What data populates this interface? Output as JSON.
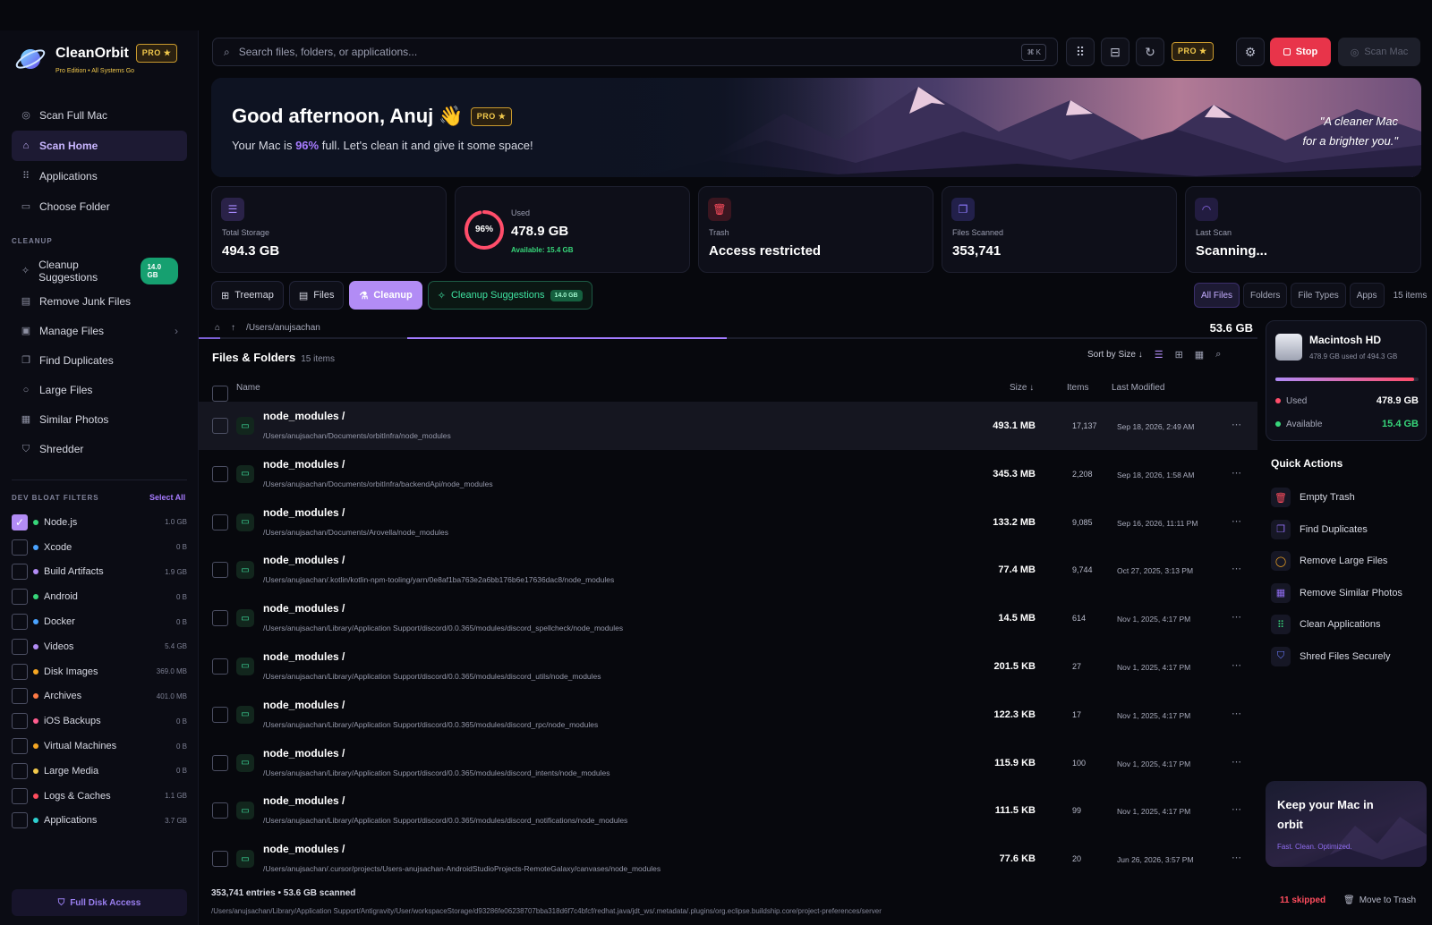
{
  "app": {
    "name": "CleanOrbit",
    "pro_badge": "PRO ★",
    "subtitle": "Pro Edition • All Systems Go",
    "accent": "#b28cf5"
  },
  "sidebar": {
    "main_items": [
      {
        "label": "Scan Full Mac",
        "icon": "scan-icon",
        "active": false
      },
      {
        "label": "Scan Home",
        "icon": "home-icon",
        "active": true
      },
      {
        "label": "Applications",
        "icon": "grid-icon",
        "active": false
      },
      {
        "label": "Choose Folder",
        "icon": "folder-icon",
        "active": false
      }
    ],
    "cleanup_label": "CLEANUP",
    "cleanup_items": [
      {
        "label": "Cleanup Suggestions",
        "icon": "sparkles-icon",
        "badge": "14.0 GB"
      },
      {
        "label": "Remove Junk Files",
        "icon": "junk-icon"
      },
      {
        "label": "Manage Files",
        "icon": "archive-icon",
        "chevron": "›"
      },
      {
        "label": "Find Duplicates",
        "icon": "copy-icon"
      },
      {
        "label": "Large Files",
        "icon": "circle-icon"
      },
      {
        "label": "Similar Photos",
        "icon": "photo-icon"
      },
      {
        "label": "Shredder",
        "icon": "shield-icon"
      }
    ],
    "filters_label": "DEV BLOAT FILTERS",
    "select_all": "Select All",
    "filters": [
      {
        "label": "Node.js",
        "size": "1.0 GB",
        "color": "#37d67a",
        "checked": true
      },
      {
        "label": "Xcode",
        "size": "0 B",
        "color": "#4aa3ff",
        "checked": false
      },
      {
        "label": "Build Artifacts",
        "size": "1.9 GB",
        "color": "#b28cf5",
        "checked": false
      },
      {
        "label": "Android",
        "size": "0 B",
        "color": "#37d67a",
        "checked": false
      },
      {
        "label": "Docker",
        "size": "0 B",
        "color": "#4aa3ff",
        "checked": false
      },
      {
        "label": "Videos",
        "size": "5.4 GB",
        "color": "#b28cf5",
        "checked": false
      },
      {
        "label": "Disk Images",
        "size": "369.0 MB",
        "color": "#f5a623",
        "checked": false
      },
      {
        "label": "Archives",
        "size": "401.0 MB",
        "color": "#ff7a45",
        "checked": false
      },
      {
        "label": "iOS Backups",
        "size": "0 B",
        "color": "#ff5d8f",
        "checked": false
      },
      {
        "label": "Virtual Machines",
        "size": "0 B",
        "color": "#f5a623",
        "checked": false
      },
      {
        "label": "Large Media",
        "size": "0 B",
        "color": "#f2c94c",
        "checked": false
      },
      {
        "label": "Logs & Caches",
        "size": "1.1 GB",
        "color": "#ff4d5e",
        "checked": false
      },
      {
        "label": "Applications",
        "size": "3.7 GB",
        "color": "#2ecfcf",
        "checked": false
      }
    ],
    "full_disk_access": "Full Disk Access"
  },
  "topbar": {
    "search_placeholder": "Search files, folders, or applications...",
    "shortcut": "⌘ K",
    "pro_badge": "PRO ★",
    "stop_label": "Stop",
    "scan_mac_label": "Scan Mac"
  },
  "hero": {
    "greeting": "Good afternoon, Anuj 👋",
    "pro_badge": "PRO ★",
    "text_before": "Your Mac is ",
    "percent": "96%",
    "text_after": " full. Let's clean it and give it some space!",
    "quote_line1": "\"A cleaner Mac",
    "quote_line2": "for a brighter you.\""
  },
  "stats": {
    "total_storage": {
      "label": "Total Storage",
      "value": "494.3 GB"
    },
    "used": {
      "label": "Used",
      "value": "478.9 GB",
      "percent_text": "96%",
      "fraction": 0.96,
      "available": "Available: 15.4 GB"
    },
    "trash": {
      "label": "Trash",
      "value": "Access restricted"
    },
    "files_scanned": {
      "label": "Files Scanned",
      "value": "353,741"
    },
    "last_scan": {
      "label": "Last Scan",
      "value": "Scanning..."
    }
  },
  "tabs": {
    "treemap": "Treemap",
    "files": "Files",
    "cleanup": "Cleanup",
    "suggestions": "Cleanup Suggestions",
    "suggestions_badge": "14.0 GB"
  },
  "filter_tabs": {
    "all": "All Files",
    "folders": "Folders",
    "types": "File Types",
    "apps": "Apps",
    "count": "15 items"
  },
  "breadcrumb": {
    "path": "/Users/anujsachan",
    "total": "53.6 GB"
  },
  "files": {
    "title": "Files & Folders",
    "count": "15 items",
    "sort": "Sort by Size ↓",
    "columns": {
      "name": "Name",
      "size": "Size ↓",
      "items": "Items",
      "modified": "Last Modified"
    },
    "rows": [
      {
        "name": "node_modules /",
        "path": "/Users/anujsachan/Documents/orbitInfra/node_modules",
        "size": "493.1 MB",
        "items": "17,137",
        "modified": "Sep 18, 2026, 2:49 AM"
      },
      {
        "name": "node_modules /",
        "path": "/Users/anujsachan/Documents/orbitInfra/backendApi/node_modules",
        "size": "345.3 MB",
        "items": "2,208",
        "modified": "Sep 18, 2026, 1:58 AM"
      },
      {
        "name": "node_modules /",
        "path": "/Users/anujsachan/Documents/Arovella/node_modules",
        "size": "133.2 MB",
        "items": "9,085",
        "modified": "Sep 16, 2026, 11:11 PM"
      },
      {
        "name": "node_modules /",
        "path": "/Users/anujsachan/.kotlin/kotlin-npm-tooling/yarn/0e8af1ba763e2a6bb176b6e17636dac8/node_modules",
        "size": "77.4 MB",
        "items": "9,744",
        "modified": "Oct 27, 2025, 3:13 PM"
      },
      {
        "name": "node_modules /",
        "path": "/Users/anujsachan/Library/Application Support/discord/0.0.365/modules/discord_spellcheck/node_modules",
        "size": "14.5 MB",
        "items": "614",
        "modified": "Nov 1, 2025, 4:17 PM"
      },
      {
        "name": "node_modules /",
        "path": "/Users/anujsachan/Library/Application Support/discord/0.0.365/modules/discord_utils/node_modules",
        "size": "201.5 KB",
        "items": "27",
        "modified": "Nov 1, 2025, 4:17 PM"
      },
      {
        "name": "node_modules /",
        "path": "/Users/anujsachan/Library/Application Support/discord/0.0.365/modules/discord_rpc/node_modules",
        "size": "122.3 KB",
        "items": "17",
        "modified": "Nov 1, 2025, 4:17 PM"
      },
      {
        "name": "node_modules /",
        "path": "/Users/anujsachan/Library/Application Support/discord/0.0.365/modules/discord_intents/node_modules",
        "size": "115.9 KB",
        "items": "100",
        "modified": "Nov 1, 2025, 4:17 PM"
      },
      {
        "name": "node_modules /",
        "path": "/Users/anujsachan/Library/Application Support/discord/0.0.365/modules/discord_notifications/node_modules",
        "size": "111.5 KB",
        "items": "99",
        "modified": "Nov 1, 2025, 4:17 PM"
      },
      {
        "name": "node_modules /",
        "path": "/Users/anujsachan/.cursor/projects/Users-anujsachan-AndroidStudioProjects-RemoteGalaxy/canvases/node_modules",
        "size": "77.6 KB",
        "items": "20",
        "modified": "Jun 26, 2026, 3:57 PM"
      }
    ]
  },
  "footer": {
    "summary": "353,741 entries • 53.6 GB scanned",
    "current_path": "/Users/anujsachan/Library/Application Support/Antigravity/User/workspaceStorage/d93286fe06238707bba318d6f7c4bfcf/redhat.java/jdt_ws/.metadata/.plugins/org.eclipse.buildship.core/project-preferences/server",
    "skipped": "11 skipped",
    "move_to_trash": "Move to Trash"
  },
  "disk": {
    "name": "Macintosh HD",
    "usage": "478.9 GB used of 494.3 GB",
    "fraction": 0.969,
    "used_label": "Used",
    "used_value": "478.9 GB",
    "available_label": "Available",
    "available_value": "15.4 GB"
  },
  "quick_actions": {
    "title": "Quick Actions",
    "items": [
      {
        "label": "Empty Trash",
        "icon": "trash-icon",
        "color": "#ff4d5e"
      },
      {
        "label": "Find Duplicates",
        "icon": "copy-icon",
        "color": "#8f6cf0"
      },
      {
        "label": "Remove Large Files",
        "icon": "ring-icon",
        "color": "#f5a623"
      },
      {
        "label": "Remove Similar Photos",
        "icon": "photo-icon",
        "color": "#8f6cf0"
      },
      {
        "label": "Clean Applications",
        "icon": "grid-icon",
        "color": "#37d67a"
      },
      {
        "label": "Shred Files Securely",
        "icon": "shield-icon",
        "color": "#6b7cff"
      }
    ]
  },
  "promo": {
    "title": "Keep your Mac in orbit",
    "subtitle": "Fast. Clean. Optimized."
  }
}
